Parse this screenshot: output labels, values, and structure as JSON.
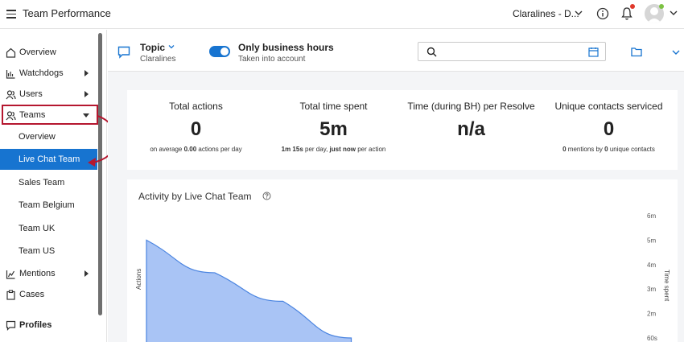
{
  "header": {
    "title": "Team Performance",
    "org": "Claralines - D..."
  },
  "sidebar": {
    "items": [
      {
        "label": "Overview",
        "icon": "home-icon"
      },
      {
        "label": "Watchdogs",
        "icon": "watchdog-icon"
      },
      {
        "label": "Users",
        "icon": "users-icon"
      },
      {
        "label": "Teams",
        "icon": "teams-icon"
      }
    ],
    "teams": [
      "Overview",
      "Live Chat Team",
      "Sales Team",
      "Team Belgium",
      "Team UK",
      "Team US"
    ],
    "active_team": "Live Chat Team",
    "lower_items": [
      {
        "label": "Mentions",
        "icon": "mentions-icon"
      },
      {
        "label": "Cases",
        "icon": "cases-icon"
      }
    ],
    "profiles": "Profiles"
  },
  "filters": {
    "topic_label": "Topic",
    "topic_value": "Claralines",
    "business_hours_label": "Only business hours",
    "business_hours_sub": "Taken into account",
    "business_hours_on": true,
    "search_placeholder": ""
  },
  "stats": [
    {
      "title": "Total actions",
      "value": "0",
      "sub_prefix": "on average ",
      "sub_bold": "0.00",
      "sub_mid": " actions per day",
      "sub_bold2": "",
      "sub_suffix": ""
    },
    {
      "title": "Total time spent",
      "value": "5m",
      "sub_prefix": "",
      "sub_bold": "1m 15s",
      "sub_mid": " per day, ",
      "sub_bold2": "just now",
      "sub_suffix": " per action"
    },
    {
      "title": "Time (during BH) per Resolve",
      "value": "n/a",
      "sub_prefix": "",
      "sub_bold": "",
      "sub_mid": "",
      "sub_bold2": "",
      "sub_suffix": ""
    },
    {
      "title": "Unique contacts serviced",
      "value": "0",
      "sub_prefix": "",
      "sub_bold": "0",
      "sub_mid": " mentions by ",
      "sub_bold2": "0",
      "sub_suffix": " unique contacts"
    }
  ],
  "activity": {
    "title": "Activity by Live Chat Team"
  },
  "chart_data": {
    "type": "area",
    "title": "Activity by Live Chat Team",
    "ylabel": "Actions",
    "y2label": "Time spent",
    "y2_ticks": [
      "6m",
      "5m",
      "4m",
      "3m",
      "2m",
      "60s"
    ],
    "y2lim_seconds": [
      60,
      360
    ],
    "series": [
      {
        "axis": "y2",
        "x": [
          0,
          0.14,
          0.28,
          0.42
        ],
        "values_seconds": [
          300,
          220,
          150,
          60
        ]
      }
    ],
    "colors": {
      "fill": "#a9c4f5",
      "stroke": "#4a84e0"
    }
  },
  "colors": {
    "accent": "#1774d0",
    "highlight": "#b5172f"
  }
}
